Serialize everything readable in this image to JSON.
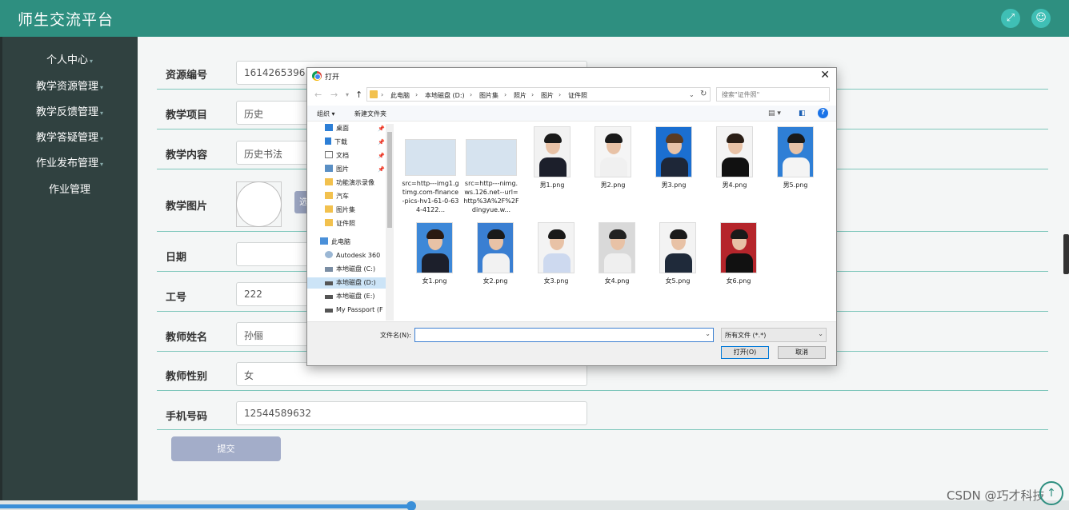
{
  "app": {
    "title": "师生交流平台",
    "watermark": "CSDN @巧才科技"
  },
  "header": {
    "fullscreen_icon": "expand-icon",
    "user_icon": "user-icon"
  },
  "sidebar": {
    "items": [
      {
        "label": "个人中心"
      },
      {
        "label": "教学资源管理"
      },
      {
        "label": "教学反馈管理"
      },
      {
        "label": "教学答疑管理"
      },
      {
        "label": "作业发布管理"
      },
      {
        "label": "作业管理"
      }
    ]
  },
  "form": {
    "rows": [
      {
        "label": "资源编号",
        "value": "1614265396"
      },
      {
        "label": "教学项目",
        "value": "历史"
      },
      {
        "label": "教学内容",
        "value": "历史书法"
      },
      {
        "label": "教学图片",
        "value": ""
      },
      {
        "label": "日期",
        "value": ""
      },
      {
        "label": "工号",
        "value": "222"
      },
      {
        "label": "教师姓名",
        "value": "孙俪"
      },
      {
        "label": "教师性别",
        "value": "女"
      },
      {
        "label": "手机号码",
        "value": "12544589632"
      }
    ],
    "pick_button": "选",
    "submit_label": "提交"
  },
  "dialog": {
    "title": "打开",
    "close": "✕",
    "breadcrumb": [
      "此电脑",
      "本地磁盘 (D:)",
      "图片集",
      "照片",
      "图片",
      "证件照"
    ],
    "search_placeholder": "搜索\"证件照\"",
    "toolbar": {
      "organize": "组织 ▾",
      "new_folder": "新建文件夹"
    },
    "nav": [
      {
        "label": "桌面",
        "pinned": true
      },
      {
        "label": "下载",
        "pinned": true
      },
      {
        "label": "文档",
        "pinned": true
      },
      {
        "label": "图片",
        "pinned": true
      },
      {
        "label": "功能演示录像"
      },
      {
        "label": "汽车"
      },
      {
        "label": "图片集"
      },
      {
        "label": "证件照"
      },
      {
        "label": "此电脑"
      },
      {
        "label": "Autodesk 360"
      },
      {
        "label": "本地磁盘 (C:)"
      },
      {
        "label": "本地磁盘 (D:)",
        "selected": true
      },
      {
        "label": "本地磁盘 (E:)"
      },
      {
        "label": "My Passport (F"
      }
    ],
    "files": [
      {
        "name": "src=http---img1.gtimg.com-finance-pics-hv1-61-0-634-4122...",
        "kind": "idcard"
      },
      {
        "name": "src=http---nimg.ws.126.net--url=http%3A%2F%2Fdingyue.w...",
        "kind": "idcard"
      },
      {
        "name": "男1.png",
        "kind": "portrait",
        "bg": "#f2f2f2",
        "hair": "#1a1a1a",
        "suit": "#1c1f2b"
      },
      {
        "name": "男2.png",
        "kind": "portrait",
        "bg": "#f5f5f5",
        "hair": "#1a1a1a",
        "suit": "#f0f0f0"
      },
      {
        "name": "男3.png",
        "kind": "portrait",
        "bg": "#1b6fd1",
        "hair": "#5a3b23",
        "suit": "#1e2738"
      },
      {
        "name": "男4.png",
        "kind": "portrait",
        "bg": "#f4f4f4",
        "hair": "#2a1e16",
        "suit": "#111111"
      },
      {
        "name": "男5.png",
        "kind": "portrait",
        "bg": "#2f7fd6",
        "hair": "#1a1a1a",
        "suit": "#f4f4f4"
      },
      {
        "name": "女1.png",
        "kind": "portrait",
        "bg": "#3d88d8",
        "hair": "#2a1a12",
        "suit": "#1c1f2b"
      },
      {
        "name": "女2.png",
        "kind": "portrait",
        "bg": "#3a7fd2",
        "hair": "#1a1a1a",
        "suit": "#f2f2f2"
      },
      {
        "name": "女3.png",
        "kind": "portrait",
        "bg": "#f3f3f3",
        "hair": "#1a1a1a",
        "suit": "#cdd9ef"
      },
      {
        "name": "女4.png",
        "kind": "portrait",
        "bg": "#d9d9d9",
        "hair": "#222222",
        "suit": "#efefef"
      },
      {
        "name": "女5.png",
        "kind": "portrait",
        "bg": "#f3f3f3",
        "hair": "#1a1a1a",
        "suit": "#1f2a3a"
      },
      {
        "name": "女6.png",
        "kind": "portrait",
        "bg": "#b5252b",
        "hair": "#1a1a1a",
        "suit": "#111111"
      }
    ],
    "filename_label": "文件名(N):",
    "filename_value": "",
    "filter": "所有文件 (*.*)",
    "open_button": "打开(O)",
    "cancel_button": "取消"
  },
  "colors": {
    "header": "#2e8f80",
    "sidebar": "#304140",
    "accent_line": "#7fc7bc",
    "submit": "#a3adc9"
  }
}
